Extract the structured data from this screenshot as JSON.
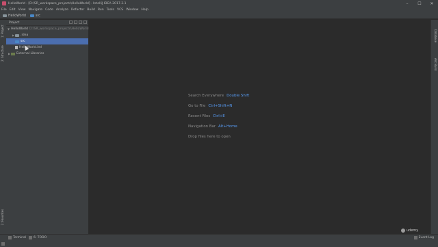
{
  "window": {
    "title": "HelloWorld - [D:\\SR_workspace_projects\\HelloWorld] - IntelliJ IDEA 2017.2.1",
    "controls": [
      "–",
      "☐",
      "✕"
    ]
  },
  "menu": [
    "File",
    "Edit",
    "View",
    "Navigate",
    "Code",
    "Analyze",
    "Refactor",
    "Build",
    "Run",
    "Tools",
    "VCS",
    "Window",
    "Help"
  ],
  "navbar": {
    "crumbs": [
      {
        "label": "HelloWorld",
        "icon": "folder-icon"
      },
      {
        "label": "src",
        "icon": "folder-icon"
      }
    ]
  },
  "left_tabs": [
    "1: Project",
    "2: Structure",
    "2: Favorites"
  ],
  "right_tabs": [
    "Database",
    "Ant Build"
  ],
  "project_panel": {
    "header": "Project",
    "tree": [
      {
        "label": "HelloWorld",
        "extra": "D:\\SR_workspace_projects\\HelloWorld",
        "indent": 0,
        "arrow": "▼",
        "icon": "folder"
      },
      {
        "label": ".idea",
        "indent": 1,
        "arrow": "▶",
        "icon": "folder"
      },
      {
        "label": "src",
        "indent": 1,
        "arrow": "",
        "icon": "folder-blue",
        "selected": true
      },
      {
        "label": "HelloWorld.iml",
        "indent": 1,
        "arrow": "",
        "icon": "file"
      },
      {
        "label": "External Libraries",
        "indent": 0,
        "arrow": "▶",
        "icon": "libs"
      }
    ]
  },
  "editor_hints": [
    {
      "label": "Search Everywhere",
      "key": "Double Shift"
    },
    {
      "label": "Go to File",
      "key": "Ctrl+Shift+N"
    },
    {
      "label": "Recent Files",
      "key": "Ctrl+E"
    },
    {
      "label": "Navigation Bar",
      "key": "Alt+Home"
    },
    {
      "label": "Drop files here to open",
      "key": ""
    }
  ],
  "statusbar": {
    "terminal": "Terminal",
    "todo": "6: TODO",
    "event_log": "Event Log"
  },
  "watermark": "udemy"
}
